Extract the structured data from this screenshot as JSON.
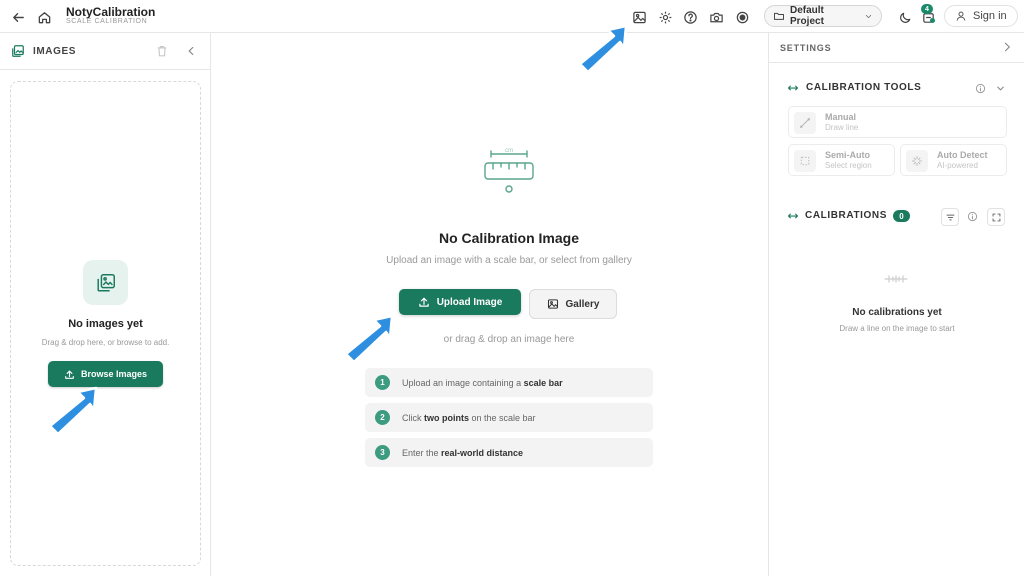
{
  "header": {
    "app_title": "NotyCalibration",
    "app_subtitle": "SCALE CALIBRATION",
    "project": "Default Project",
    "notification_count": "4",
    "sign_in": "Sign in"
  },
  "images_panel": {
    "title": "IMAGES",
    "empty_title": "No images yet",
    "empty_subtitle": "Drag & drop here, or browse to add.",
    "browse_button": "Browse Images"
  },
  "main": {
    "title": "No Calibration Image",
    "subtitle": "Upload an image with a scale bar, or select from gallery",
    "upload_button": "Upload Image",
    "gallery_button": "Gallery",
    "drag_hint": "or drag & drop an image here",
    "ruler_label": "cm",
    "steps": [
      {
        "num": "1",
        "pre": "Upload an image containing a ",
        "bold": "scale bar",
        "post": ""
      },
      {
        "num": "2",
        "pre": "Click ",
        "bold": "two points",
        "post": " on the scale bar"
      },
      {
        "num": "3",
        "pre": "Enter the ",
        "bold": "real-world distance",
        "post": ""
      }
    ]
  },
  "settings_panel": {
    "title": "SETTINGS",
    "calibration_tools": {
      "title": "CALIBRATION TOOLS",
      "tools": [
        {
          "name": "Manual",
          "desc": "Draw line"
        },
        {
          "name": "Semi-Auto",
          "desc": "Select region"
        },
        {
          "name": "Auto Detect",
          "desc": "AI-powered"
        }
      ]
    },
    "calibrations": {
      "title": "CALIBRATIONS",
      "count": "0",
      "empty_title": "No calibrations yet",
      "empty_subtitle": "Draw a line on the image to start"
    }
  },
  "colors": {
    "accent": "#1a7a5e",
    "accent_light": "#e6f2ee",
    "pointer_arrow": "#2e8fe0"
  }
}
